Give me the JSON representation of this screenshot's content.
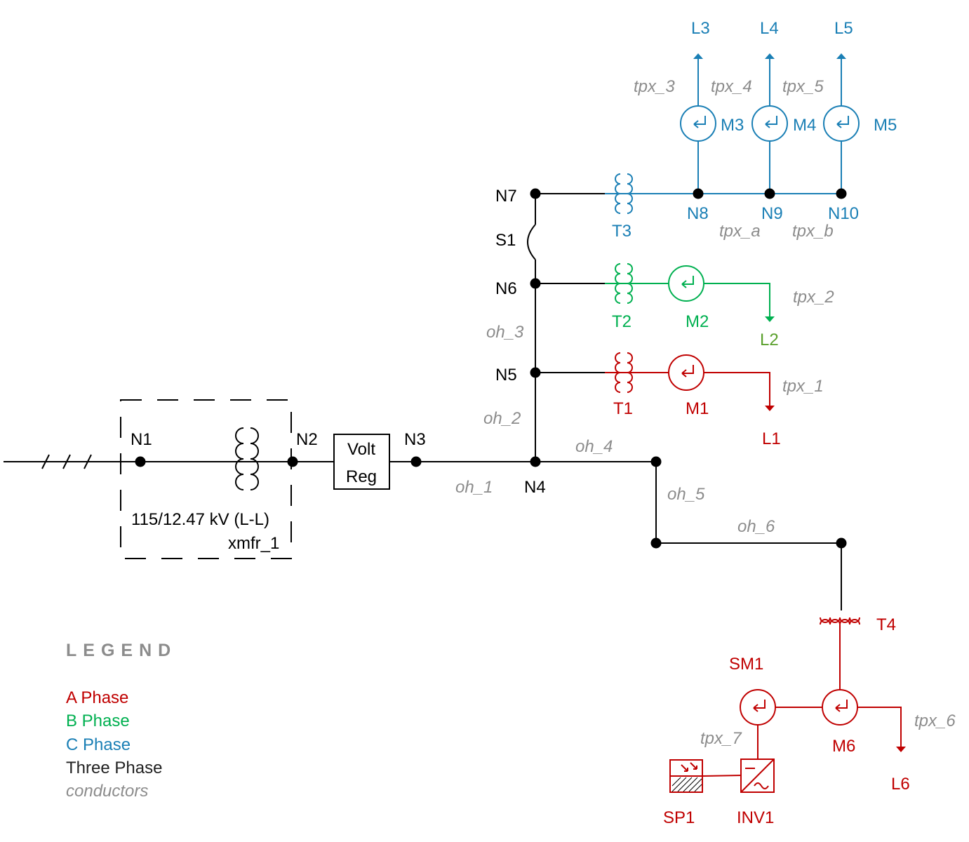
{
  "colors": {
    "a_phase": "#c00000",
    "b_phase": "#00b050",
    "c_phase": "#1a7fb5",
    "three_phase": "#000000",
    "conductor_label": "#8c8c8c"
  },
  "nodes": {
    "n1": "N1",
    "n2": "N2",
    "n3": "N3",
    "n4": "N4",
    "n5": "N5",
    "n6": "N6",
    "n7": "N7",
    "n8": "N8",
    "n9": "N9",
    "n10": "N10"
  },
  "substation": {
    "rating": "115/12.47 kV  (L-L)",
    "name": "xmfr_1"
  },
  "regulator": {
    "line1": "Volt",
    "line2": "Reg"
  },
  "switch": "S1",
  "transformers": {
    "t1": "T1",
    "t2": "T2",
    "t3": "T3",
    "t4": "T4"
  },
  "meters": {
    "m1": "M1",
    "m2": "M2",
    "m3": "M3",
    "m4": "M4",
    "m5": "M5",
    "m6": "M6",
    "sm1": "SM1"
  },
  "loads": {
    "l1": "L1",
    "l2": "L2",
    "l3": "L3",
    "l4": "L4",
    "l5": "L5",
    "l6": "L6"
  },
  "der": {
    "sp1": "SP1",
    "inv1": "INV1"
  },
  "conductors": {
    "oh_1": "oh_1",
    "oh_2": "oh_2",
    "oh_3": "oh_3",
    "oh_4": "oh_4",
    "oh_5": "oh_5",
    "oh_6": "oh_6",
    "tpx_1": "tpx_1",
    "tpx_2": "tpx_2",
    "tpx_3": "tpx_3",
    "tpx_4": "tpx_4",
    "tpx_5": "tpx_5",
    "tpx_6": "tpx_6",
    "tpx_7": "tpx_7",
    "tpx_a": "tpx_a",
    "tpx_b": "tpx_b"
  },
  "legend": {
    "title": "LEGEND",
    "a": "A Phase",
    "b": "B Phase",
    "c": "C Phase",
    "three": "Three Phase",
    "conductors": "conductors"
  }
}
